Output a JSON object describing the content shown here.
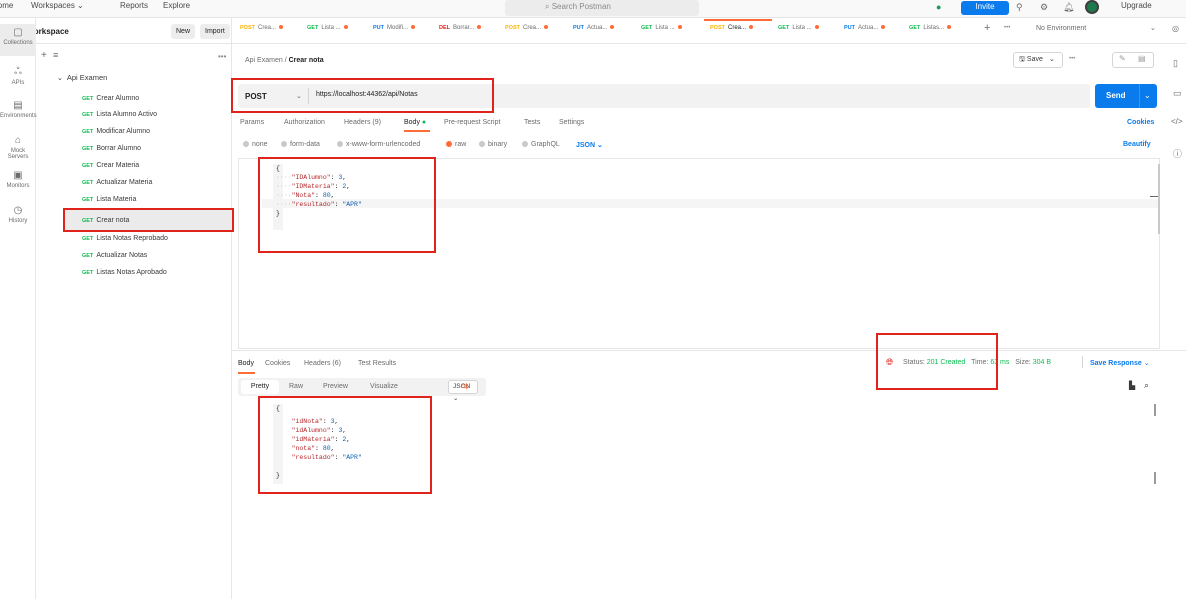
{
  "topbar": {
    "nav": [
      "Home",
      "Workspaces",
      "Reports",
      "Explore"
    ],
    "search_placeholder": "Search Postman",
    "invite_label": "Invite",
    "upgrade_label": "Upgrade"
  },
  "workspace": {
    "title": "My Workspace",
    "new_label": "New",
    "import_label": "Import"
  },
  "rail": [
    {
      "label": "Collections",
      "icon": "collections-icon"
    },
    {
      "label": "APIs",
      "icon": "apis-icon"
    },
    {
      "label": "Environments",
      "icon": "environments-icon"
    },
    {
      "label": "Mock Servers",
      "icon": "mock-servers-icon"
    },
    {
      "label": "Monitors",
      "icon": "monitors-icon"
    },
    {
      "label": "History",
      "icon": "history-icon"
    }
  ],
  "tree": {
    "collection": "Api Examen",
    "items": [
      {
        "method": "GET",
        "label": "Crear Alumno"
      },
      {
        "method": "GET",
        "label": "Lista Alumno Activo"
      },
      {
        "method": "GET",
        "label": "Modificar Alumno"
      },
      {
        "method": "GET",
        "label": "Borrar Alumno"
      },
      {
        "method": "GET",
        "label": "Crear Materia"
      },
      {
        "method": "GET",
        "label": "Actualizar Materia"
      },
      {
        "method": "GET",
        "label": "Lista Materia"
      },
      {
        "method": "GET",
        "label": "Crear nota"
      },
      {
        "method": "GET",
        "label": "Lista Notas Reprobado"
      },
      {
        "method": "GET",
        "label": "Actualizar Notas"
      },
      {
        "method": "GET",
        "label": "Listas Notas Aprobado"
      }
    ]
  },
  "tabs": [
    {
      "method": "POST",
      "label": "Crea..."
    },
    {
      "method": "GET",
      "label": "Lista ..."
    },
    {
      "method": "PUT",
      "label": "Modifi..."
    },
    {
      "method": "DEL",
      "label": "Borrar..."
    },
    {
      "method": "POST",
      "label": "Crea..."
    },
    {
      "method": "PUT",
      "label": "Actua..."
    },
    {
      "method": "GET",
      "label": "Lista ..."
    },
    {
      "method": "POST",
      "label": "Crea..."
    },
    {
      "method": "GET",
      "label": "Lista ..."
    },
    {
      "method": "PUT",
      "label": "Actua..."
    },
    {
      "method": "GET",
      "label": "Listas..."
    }
  ],
  "environment": "No Environment",
  "breadcrumb": {
    "parent": "Api Examen",
    "sep": "/",
    "current": "Crear nota"
  },
  "save_label": "Save",
  "request": {
    "method": "POST",
    "url": "https://localhost:44362/api/Notas",
    "send_label": "Send",
    "tabs": [
      "Params",
      "Authorization",
      "Headers (9)",
      "Body",
      "Pre-request Script",
      "Tests",
      "Settings"
    ],
    "cookies_label": "Cookies",
    "body_options": [
      "none",
      "form-data",
      "x-www-form-urlencoded",
      "raw",
      "binary",
      "GraphQL"
    ],
    "body_format": "JSON",
    "beautify_label": "Beautify",
    "body_lines": [
      {
        "key": "\"IDAlumno\"",
        "value": "3"
      },
      {
        "key": "\"IDMateria\"",
        "value": "2"
      },
      {
        "key": "\"Nota\"",
        "value": "80"
      },
      {
        "key": "\"resultado\"",
        "value": "\"APR\""
      }
    ]
  },
  "response": {
    "tabs": [
      "Body",
      "Cookies",
      "Headers (6)",
      "Test Results"
    ],
    "status_label": "Status:",
    "status_value": "201 Created",
    "time_label": "Time:",
    "time_value": "63 ms",
    "size_label": "Size:",
    "size_value": "304 B",
    "save_response_label": "Save Response",
    "views": [
      "Pretty",
      "Raw",
      "Preview",
      "Visualize"
    ],
    "format": "JSON",
    "body_lines": [
      {
        "key": "\"idNota\"",
        "value": "3"
      },
      {
        "key": "\"idAlumno\"",
        "value": "3"
      },
      {
        "key": "\"idMateria\"",
        "value": "2"
      },
      {
        "key": "\"nota\"",
        "value": "80"
      },
      {
        "key": "\"resultado\"",
        "value": "\"APR\""
      }
    ]
  },
  "colors": {
    "accent": "#ff6c37",
    "primary": "#097bed",
    "annotation": "#e0241c",
    "status_ok": "#0cbb52"
  }
}
